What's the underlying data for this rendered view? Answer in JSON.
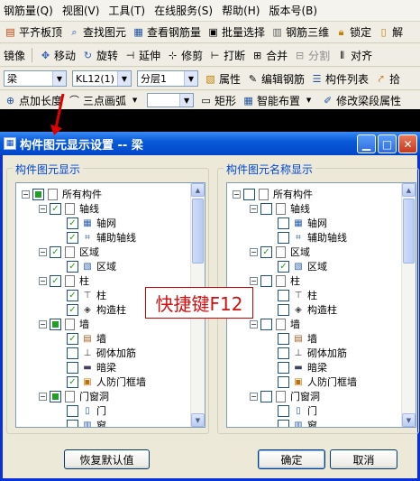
{
  "menubar": {
    "items": [
      "钢筋量(Q)",
      "视图(V)",
      "工具(T)",
      "在线服务(S)",
      "帮助(H)",
      "版本号(B)"
    ]
  },
  "toolbar1": {
    "items": [
      {
        "label": "平齐板顶",
        "icon": "align-slab-icon"
      },
      {
        "label": "查找图元",
        "icon": "find-icon"
      },
      {
        "label": "查看钢筋量",
        "icon": "rebar-quantity-icon"
      },
      {
        "label": "批量选择",
        "icon": "batch-select-icon"
      },
      {
        "label": "钢筋三维",
        "icon": "rebar-3d-icon"
      },
      {
        "label": "锁定",
        "icon": "lock-icon"
      },
      {
        "label": "解",
        "icon": "unlock-icon"
      }
    ]
  },
  "toolbar2": {
    "items": [
      {
        "label": "镜像",
        "icon": ""
      },
      {
        "label": "移动",
        "icon": "move-icon"
      },
      {
        "label": "旋转",
        "icon": "rotate-icon"
      },
      {
        "label": "延伸",
        "icon": "extend-icon"
      },
      {
        "label": "修剪",
        "icon": "trim-icon"
      },
      {
        "label": "打断",
        "icon": "break-icon"
      },
      {
        "label": "合并",
        "icon": "merge-icon"
      },
      {
        "label": "分割",
        "icon": "split-icon"
      },
      {
        "label": "对齐",
        "icon": "align-icon"
      }
    ]
  },
  "toolbar3": {
    "type_value": "梁",
    "name_value": "KL12(1)",
    "layer_value": "分层1",
    "items": [
      {
        "label": "属性",
        "icon": "properties-icon"
      },
      {
        "label": "编辑钢筋",
        "icon": "edit-rebar-icon"
      },
      {
        "label": "构件列表",
        "icon": "component-list-icon"
      },
      {
        "label": "拾",
        "icon": "pick-icon"
      }
    ]
  },
  "toolbar4": {
    "items": [
      {
        "label": "点加长度",
        "icon": "point-length-icon"
      },
      {
        "label": "三点画弧",
        "icon": "arc-icon"
      },
      {
        "label": "矩形",
        "icon": "rectangle-icon"
      },
      {
        "label": "智能布置",
        "icon": "smart-layout-icon"
      },
      {
        "label": "修改梁段属性",
        "icon": "modify-beam-icon"
      }
    ]
  },
  "dialog": {
    "title": "构件图元显示设置 -- 梁",
    "left_group": "构件图元显示",
    "right_group": "构件图元名称显示",
    "restore_button": "恢复默认值",
    "ok_button": "确定",
    "cancel_button": "取消",
    "hint": "快捷键F12"
  },
  "left_tree": [
    {
      "label": "所有构件",
      "level": 0,
      "expander": "−",
      "check": "partial",
      "icon": "doc-icon"
    },
    {
      "label": "轴线",
      "level": 1,
      "expander": "−",
      "check": "checked",
      "icon": "doc-icon"
    },
    {
      "label": "轴网",
      "level": 2,
      "expander": "",
      "check": "checked",
      "icon": "grid-icon"
    },
    {
      "label": "辅助轴线",
      "level": 2,
      "expander": "",
      "check": "checked",
      "icon": "aux-axis-icon"
    },
    {
      "label": "区域",
      "level": 1,
      "expander": "−",
      "check": "checked",
      "icon": "doc-icon"
    },
    {
      "label": "区域",
      "level": 2,
      "expander": "",
      "check": "checked",
      "icon": "region-icon"
    },
    {
      "label": "柱",
      "level": 1,
      "expander": "−",
      "check": "checked",
      "icon": "doc-icon"
    },
    {
      "label": "柱",
      "level": 2,
      "expander": "",
      "check": "checked",
      "icon": "column-icon"
    },
    {
      "label": "构造柱",
      "level": 2,
      "expander": "",
      "check": "checked",
      "icon": "constructional-column-icon"
    },
    {
      "label": "墙",
      "level": 1,
      "expander": "−",
      "check": "partial",
      "icon": "doc-icon"
    },
    {
      "label": "墙",
      "level": 2,
      "expander": "",
      "check": "checked",
      "icon": "wall-icon"
    },
    {
      "label": "砌体加筋",
      "level": 2,
      "expander": "",
      "check": "unchecked",
      "icon": "masonry-rebar-icon"
    },
    {
      "label": "暗梁",
      "level": 2,
      "expander": "",
      "check": "unchecked",
      "icon": "hidden-beam-icon"
    },
    {
      "label": "人防门框墙",
      "level": 2,
      "expander": "",
      "check": "checked",
      "icon": "civil-defense-door-icon"
    },
    {
      "label": "门窗洞",
      "level": 1,
      "expander": "−",
      "check": "partial",
      "icon": "doc-icon"
    },
    {
      "label": "门",
      "level": 2,
      "expander": "",
      "check": "unchecked",
      "icon": "door-icon"
    },
    {
      "label": "窗",
      "level": 2,
      "expander": "",
      "check": "unchecked",
      "icon": "window-icon"
    }
  ],
  "right_tree": [
    {
      "label": "所有构件",
      "level": 0,
      "expander": "−",
      "check": "unchecked",
      "icon": "doc-icon"
    },
    {
      "label": "轴线",
      "level": 1,
      "expander": "−",
      "check": "unchecked",
      "icon": "doc-icon"
    },
    {
      "label": "轴网",
      "level": 2,
      "expander": "",
      "check": "unchecked",
      "icon": "grid-icon"
    },
    {
      "label": "辅助轴线",
      "level": 2,
      "expander": "",
      "check": "unchecked",
      "icon": "aux-axis-icon"
    },
    {
      "label": "区域",
      "level": 1,
      "expander": "−",
      "check": "checked",
      "icon": "doc-icon"
    },
    {
      "label": "区域",
      "level": 2,
      "expander": "",
      "check": "checked",
      "icon": "region-icon"
    },
    {
      "label": "柱",
      "level": 1,
      "expander": "−",
      "check": "unchecked",
      "icon": "doc-icon"
    },
    {
      "label": "柱",
      "level": 2,
      "expander": "",
      "check": "unchecked",
      "icon": "column-icon"
    },
    {
      "label": "构造柱",
      "level": 2,
      "expander": "",
      "check": "unchecked",
      "icon": "constructional-column-icon"
    },
    {
      "label": "墙",
      "level": 1,
      "expander": "−",
      "check": "unchecked",
      "icon": "doc-icon"
    },
    {
      "label": "墙",
      "level": 2,
      "expander": "",
      "check": "unchecked",
      "icon": "wall-icon"
    },
    {
      "label": "砌体加筋",
      "level": 2,
      "expander": "",
      "check": "unchecked",
      "icon": "masonry-rebar-icon"
    },
    {
      "label": "暗梁",
      "level": 2,
      "expander": "",
      "check": "unchecked",
      "icon": "hidden-beam-icon"
    },
    {
      "label": "人防门框墙",
      "level": 2,
      "expander": "",
      "check": "unchecked",
      "icon": "civil-defense-door-icon"
    },
    {
      "label": "门窗洞",
      "level": 1,
      "expander": "−",
      "check": "unchecked",
      "icon": "doc-icon"
    },
    {
      "label": "门",
      "level": 2,
      "expander": "",
      "check": "unchecked",
      "icon": "door-icon"
    },
    {
      "label": "窗",
      "level": 2,
      "expander": "",
      "check": "unchecked",
      "icon": "window-icon"
    }
  ],
  "colors": {
    "titlebar": "#0a5bd8",
    "group_label": "#0046d5",
    "check": "#21a121",
    "hint": "#d01010"
  }
}
